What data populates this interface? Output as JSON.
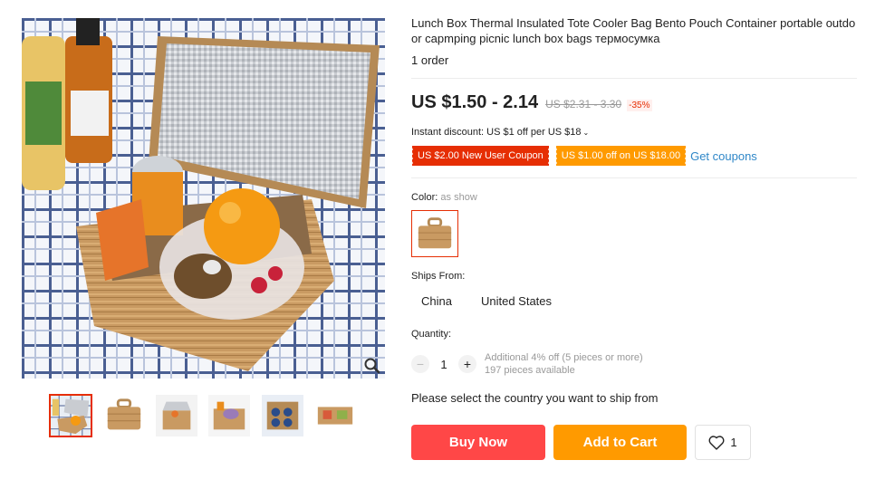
{
  "gallery": {
    "main_image_alt": "Lunch box thermal insulated tote with drinks, orange and kiwi",
    "zoom_icon": "magnifier-icon",
    "thumbnails_count": 6,
    "active_thumbnail": 0
  },
  "product": {
    "title": "Lunch Box Thermal Insulated Tote Cooler Bag Bento Pouch Container portable outdoor capmping picnic lunch box bags термосумка",
    "orders": "1 order",
    "price": "US $1.50 - 2.14",
    "original_price": "US $2.31 - 3.30",
    "discount": "-35%",
    "instant_discount": "Instant discount: US $1 off per US $18",
    "coupons": [
      "US $2.00 New User Coupon",
      "US $1.00 off on US $18.00"
    ],
    "get_coupons": "Get coupons"
  },
  "color": {
    "label": "Color:",
    "value": "as show"
  },
  "shipping": {
    "label": "Ships From:",
    "options": [
      "China",
      "United States"
    ]
  },
  "quantity": {
    "label": "Quantity:",
    "minus": "−",
    "value": "1",
    "plus": "+",
    "note_bulk": "Additional 4% off (5 pieces or more)",
    "note_available": "197 pieces available"
  },
  "notice": "Please select the country you want to ship from",
  "actions": {
    "buy_now": "Buy Now",
    "add_to_cart": "Add to Cart",
    "wishlist_count": "1"
  },
  "colors": {
    "accent_red": "#e62e04",
    "buy_now": "#ff4747",
    "add_to_cart": "#ff9a00",
    "link_blue": "#2f87c8"
  }
}
